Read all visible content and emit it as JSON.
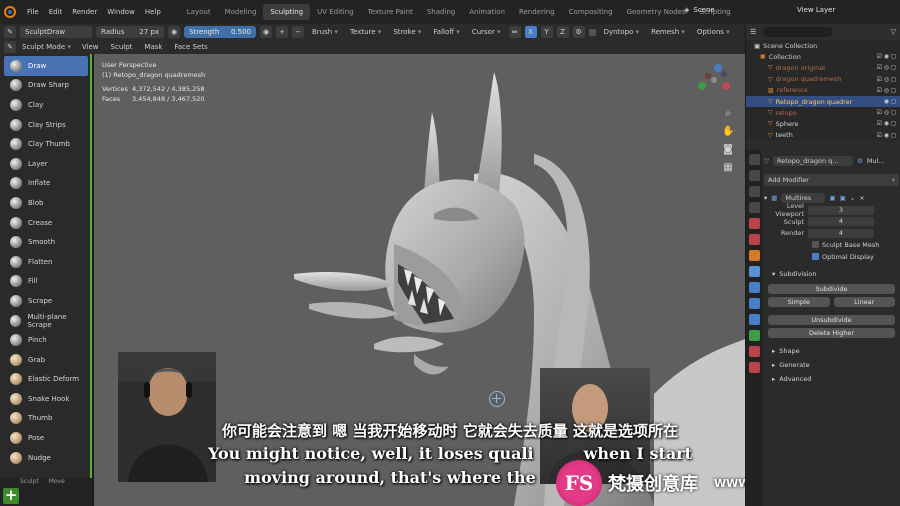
{
  "menubar": {
    "items": [
      "File",
      "Edit",
      "Render",
      "Window",
      "Help"
    ],
    "workspaces": [
      "Layout",
      "Modeling",
      "Sculpting",
      "UV Editing",
      "Texture Paint",
      "Shading",
      "Animation",
      "Rendering",
      "Compositing",
      "Geometry Nodes",
      "Scripting"
    ],
    "active_workspace": "Sculpting",
    "scene": "Scene",
    "view_layer": "View Layer"
  },
  "tool_header": {
    "brush_name": "SculptDraw",
    "radius_label": "Radius",
    "radius_value": "27 px",
    "strength_label": "Strength",
    "strength_value": "0.500",
    "menus": [
      "Brush",
      "Texture",
      "Stroke",
      "Falloff",
      "Cursor"
    ],
    "axes": [
      "X",
      "Y",
      "Z"
    ],
    "dyntopo": "Dyntopo",
    "remesh": "Remesh",
    "options": "Options"
  },
  "mode_header": {
    "mode": "Sculpt Mode",
    "items": [
      "View",
      "Sculpt",
      "Mask",
      "Face Sets"
    ]
  },
  "tools": [
    {
      "label": "Draw",
      "active": true
    },
    {
      "label": "Draw Sharp"
    },
    {
      "label": "Clay"
    },
    {
      "label": "Clay Strips"
    },
    {
      "label": "Clay Thumb"
    },
    {
      "label": "Layer"
    },
    {
      "label": "Inflate"
    },
    {
      "label": "Blob"
    },
    {
      "label": "Crease"
    },
    {
      "label": "Smooth"
    },
    {
      "label": "Flatten"
    },
    {
      "label": "Fill"
    },
    {
      "label": "Scrape"
    },
    {
      "label": "Multi-plane Scrape"
    },
    {
      "label": "Pinch"
    },
    {
      "label": "Grab"
    },
    {
      "label": "Elastic Deform"
    },
    {
      "label": "Snake Hook"
    },
    {
      "label": "Thumb"
    },
    {
      "label": "Pose"
    },
    {
      "label": "Nudge"
    }
  ],
  "status_bar": {
    "items": [
      "Sculpt",
      "Move"
    ]
  },
  "viewport": {
    "view_name": "User Perspective",
    "object_label": "(1) Retopo_dragon quadremesh",
    "vertices_label": "Vertices",
    "vertices_value": "4,372,542 / 4,385,258",
    "faces_label": "Faces",
    "faces_value": "3,454,848 / 3,467,520"
  },
  "subtitles": {
    "chinese": "你可能会注意到 嗯 当我开始移动时 它就会失去质量 这就是选项所在",
    "english_line1": "You might notice, well, it loses quali",
    "english_line1_tail": "when I start",
    "english_line2": "moving around, that's where the"
  },
  "watermark": {
    "logo": "FS",
    "name": "梵摄创意库",
    "url": "WWW.FSTVC.CC"
  },
  "outliner": {
    "root": "Scene Collection",
    "rows": [
      {
        "label": "Collection",
        "indent": 1
      },
      {
        "label": "dragon original",
        "indent": 2,
        "dim": true
      },
      {
        "label": "dragon quadremesh",
        "indent": 2,
        "dim": true
      },
      {
        "label": "reference",
        "indent": 2,
        "dim": true
      },
      {
        "label": "Retopo_dragon quadrer",
        "indent": 2,
        "selected": true
      },
      {
        "label": "retopo",
        "indent": 2,
        "dim": true
      },
      {
        "label": "Sphere",
        "indent": 2
      },
      {
        "label": "teeth",
        "indent": 2
      }
    ]
  },
  "properties": {
    "object_name": "Retopo_dragon q...",
    "modifier_short": "Mul...",
    "add_modifier": "Add Modifier",
    "modifier_name": "Multires",
    "level_viewport_label": "Level Viewport",
    "level_viewport": "3",
    "sculpt_label": "Sculpt",
    "sculpt": "4",
    "render_label": "Render",
    "render": "4",
    "sculpt_base_mesh": "Sculpt Base Mesh",
    "optimal_display": "Optimal Display",
    "subdivision": "Subdivision",
    "subdivide": "Subdivide",
    "simple": "Simple",
    "linear": "Linear",
    "unsubdivide": "Unsubdivide",
    "delete_higher": "Delete Higher",
    "shape": "Shape",
    "generate": "Generate",
    "advanced": "Advanced"
  }
}
